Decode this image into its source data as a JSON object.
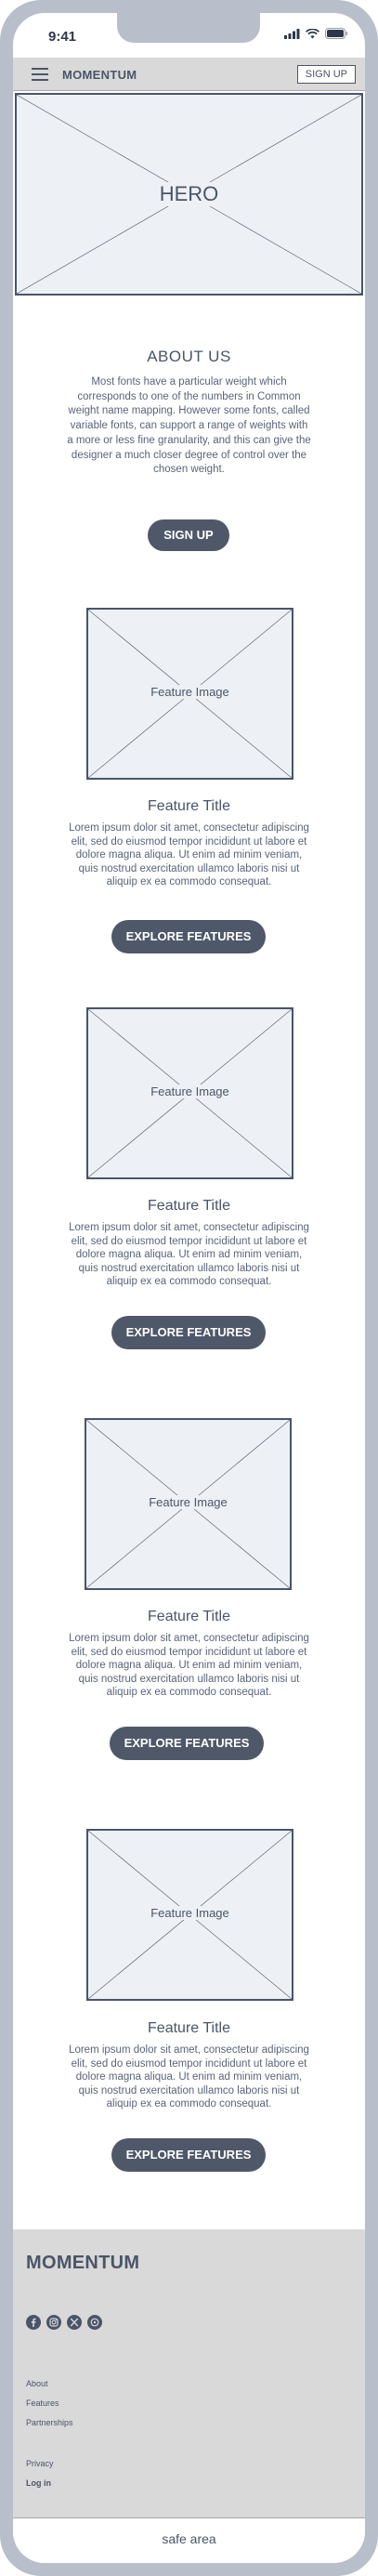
{
  "status": {
    "time": "9:41"
  },
  "navbar": {
    "brand": "MOMENTUM",
    "signup_label": "SIGN UP"
  },
  "hero": {
    "label": "HERO"
  },
  "about": {
    "title": "ABOUT US",
    "text": "Most fonts have a particular weight which corresponds to one of the numbers in Common weight name mapping. However some fonts, called variable fonts, can support a range of weights with a more or less fine granularity, and this can give the designer a much closer degree of control over the chosen weight.",
    "button_label": "SIGN UP"
  },
  "features": [
    {
      "image_label": "Feature Image",
      "title": "Feature Title",
      "text": "Lorem ipsum dolor sit amet, consectetur adipiscing elit, sed do eiusmod tempor incididunt ut labore et dolore magna aliqua. Ut enim ad minim veniam, quis nostrud exercitation ullamco laboris nisi ut aliquip ex ea commodo consequat.",
      "button_label": "EXPLORE FEATURES"
    },
    {
      "image_label": "Feature Image",
      "title": "Feature Title",
      "text": "Lorem ipsum dolor sit amet, consectetur adipiscing elit, sed do eiusmod tempor incididunt ut labore et dolore magna aliqua. Ut enim ad minim veniam, quis nostrud exercitation ullamco laboris nisi ut aliquip ex ea commodo consequat.",
      "button_label": "EXPLORE FEATURES"
    },
    {
      "image_label": "Feature Image",
      "title": "Feature Title",
      "text": "Lorem ipsum dolor sit amet, consectetur adipiscing elit, sed do eiusmod tempor incididunt ut labore et dolore magna aliqua. Ut enim ad minim veniam, quis nostrud exercitation ullamco laboris nisi ut aliquip ex ea commodo consequat.",
      "button_label": "EXPLORE FEATURES"
    },
    {
      "image_label": "Feature Image",
      "title": "Feature Title",
      "text": "Lorem ipsum dolor sit amet, consectetur adipiscing elit, sed do eiusmod tempor incididunt ut labore et dolore magna aliqua. Ut enim ad minim veniam, quis nostrud exercitation ullamco laboris nisi ut aliquip ex ea commodo consequat.",
      "button_label": "EXPLORE FEATURES"
    }
  ],
  "footer": {
    "brand": "MOMENTUM",
    "social_icons": [
      "facebook-icon",
      "instagram-icon",
      "x-icon",
      "whatsapp-icon"
    ],
    "links": [
      "About",
      "Features",
      "Partnerships"
    ],
    "secondary_links": [
      "Privacy",
      "Log in"
    ]
  },
  "safe_area": {
    "label": "safe area"
  },
  "colors": {
    "primary": "#4f5868",
    "text": "#4a5568",
    "frame": "#b8bfcb",
    "panel": "#d9d9d9",
    "placeholder": "#edf1f5"
  }
}
